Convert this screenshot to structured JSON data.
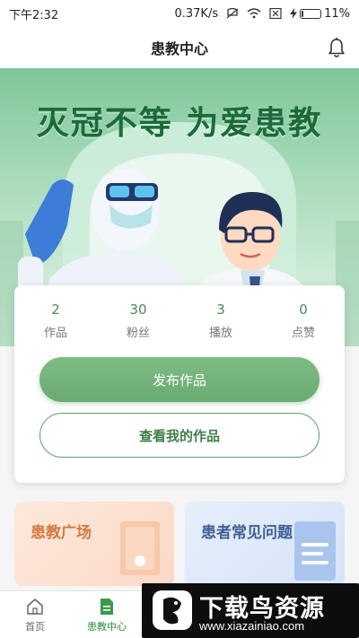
{
  "status_bar": {
    "time": "下午2:32",
    "speed": "0.37K/s",
    "battery": "11%",
    "battery_level": 0.11
  },
  "nav": {
    "title": "患教中心",
    "bell_icon": "bell-icon"
  },
  "banner": {
    "slogan": "灭冠不等 为爱患教"
  },
  "stats": [
    {
      "value": "2",
      "label": "作品"
    },
    {
      "value": "30",
      "label": "粉丝"
    },
    {
      "value": "3",
      "label": "播放"
    },
    {
      "value": "0",
      "label": "点赞"
    }
  ],
  "actions": {
    "publish": "发布作品",
    "view_mine": "查看我的作品"
  },
  "tiles": {
    "square": "患教广场",
    "faq": "患者常见问题"
  },
  "tabbar": {
    "home": "首页",
    "center": "患教中心"
  },
  "watermark": {
    "brand": "下载鸟资源",
    "url": "www.xiazainiao.com"
  },
  "colors": {
    "primary": "#6aab72",
    "banner_dark": "#1c6a3a",
    "tile_orange": "#d5793f",
    "tile_blue": "#3e5f95"
  }
}
